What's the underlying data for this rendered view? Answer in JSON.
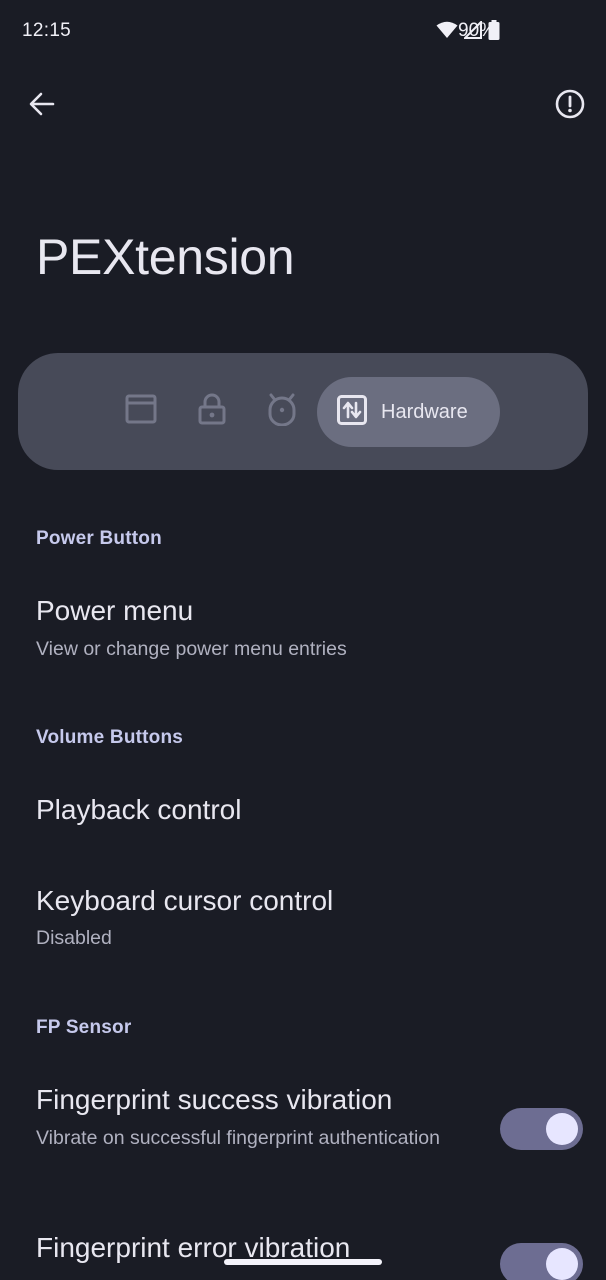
{
  "status_bar": {
    "time": "12:15",
    "battery_percent": "90%"
  },
  "app": {
    "title": "PEXtension"
  },
  "tabs": {
    "items": [
      {
        "icon": "window-icon"
      },
      {
        "icon": "lock-icon"
      },
      {
        "icon": "android-icon"
      },
      {
        "icon": "hardware-icon",
        "label": "Hardware",
        "selected": true
      }
    ]
  },
  "sections": [
    {
      "header": "Power Button",
      "items": [
        {
          "title": "Power menu",
          "summary": "View or change power menu entries"
        }
      ]
    },
    {
      "header": "Volume Buttons",
      "items": [
        {
          "title": "Playback control"
        },
        {
          "title": "Keyboard cursor control",
          "summary": "Disabled"
        }
      ]
    },
    {
      "header": "FP Sensor",
      "items": [
        {
          "title": "Fingerprint success vibration",
          "summary": "Vibrate on successful fingerprint authentication",
          "switch_on": true
        },
        {
          "title": "Fingerprint error vibration",
          "switch_on": true
        }
      ]
    }
  ],
  "colors": {
    "background": "#1a1c25",
    "tab_strip": "#474a58",
    "tab_active": "#6b6e80",
    "section_header": "#c6c9ec",
    "switch_track": "#6d6d92",
    "switch_thumb": "#e7e6ff"
  }
}
